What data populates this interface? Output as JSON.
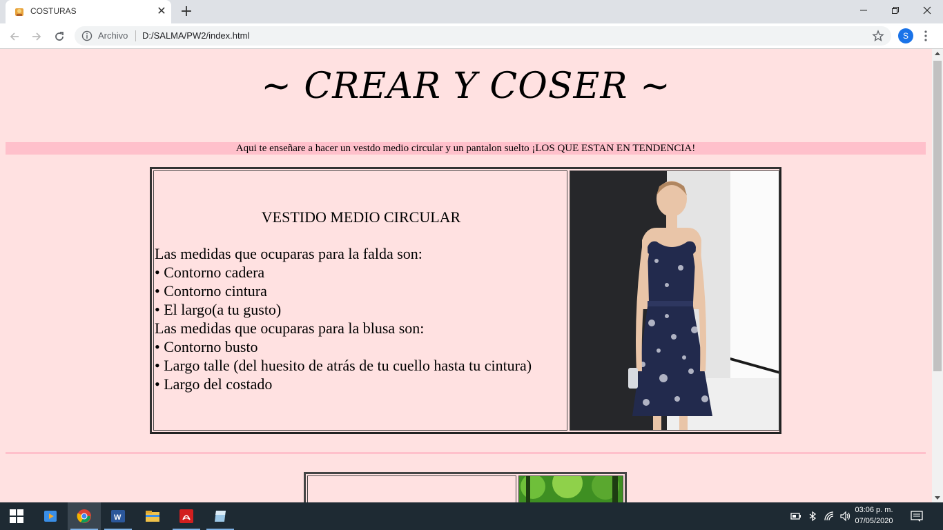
{
  "browser": {
    "tab_title": "COSTURAS",
    "address_scheme": "Archivo",
    "address_url": "D:/SALMA/PW2/index.html",
    "profile_initial": "S"
  },
  "page": {
    "heading": "~ CREAR Y COSER ~",
    "banner": "Aqui te enseñare a hacer un vestdo medio circular y un pantalon suelto ¡LOS QUE ESTAN EN TENDENCIA!",
    "section1": {
      "title": "VESTIDO MEDIO CIRCULAR",
      "lines": [
        "Las medidas que ocuparas para la falda son:",
        "• Contorno cadera",
        "• Contorno cintura",
        "• El largo(a tu gusto)",
        "Las medidas que ocuparas para la blusa son:",
        "• Contorno busto",
        "• Largo talle (del huesito de atrás de tu cuello hasta tu cintura)",
        "• Largo del costado"
      ]
    }
  },
  "taskbar": {
    "time": "03:06 p. m.",
    "date": "07/05/2020"
  },
  "colors": {
    "page_bg": "#ffe1e1",
    "banner_bg": "#ffc0cb",
    "taskbar_bg": "#1e2a33"
  }
}
